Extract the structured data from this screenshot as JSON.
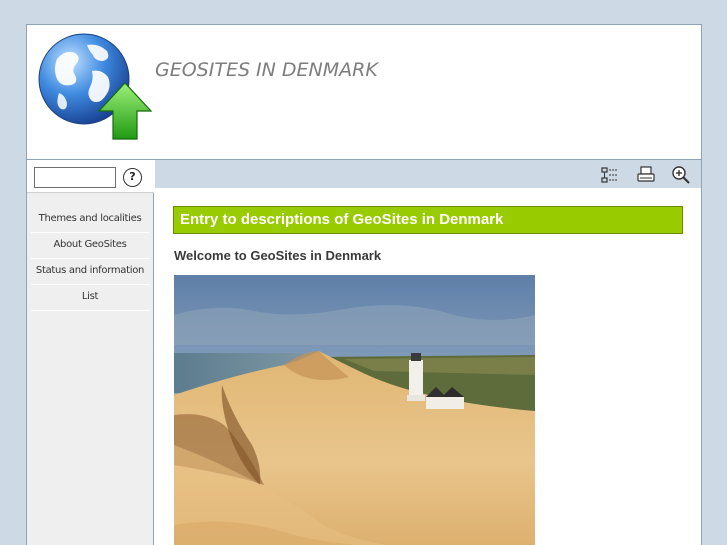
{
  "header": {
    "title": "GEOSITES IN DENMARK"
  },
  "search": {
    "value": "",
    "placeholder": "",
    "help_label": "?"
  },
  "sidebar": {
    "items": [
      {
        "label": "Themes and localities"
      },
      {
        "label": "About GeoSites"
      },
      {
        "label": "Status and information"
      },
      {
        "label": "List"
      }
    ]
  },
  "toolbar": {
    "icons": [
      "sitemap-icon",
      "print-icon",
      "zoom-in-icon"
    ]
  },
  "main": {
    "heading": "Entry to descriptions of GeoSites in Denmark",
    "welcome": "Welcome to GeoSites in Denmark"
  },
  "colors": {
    "page_bg": "#cdd9e5",
    "heading_bg": "#99cc00",
    "sidebar_bg": "#efefef"
  }
}
